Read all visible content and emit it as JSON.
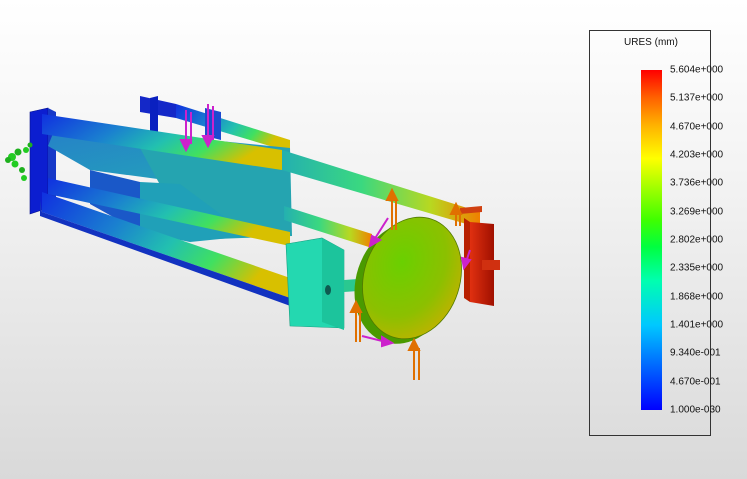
{
  "legend": {
    "title": "URES (mm)",
    "ticks": [
      "5.604e+000",
      "5.137e+000",
      "4.670e+000",
      "4.203e+000",
      "3.736e+000",
      "3.269e+000",
      "2.802e+000",
      "2.335e+000",
      "1.868e+000",
      "1.401e+000",
      "9.340e-001",
      "4.670e-001",
      "1.000e-030"
    ],
    "colors": {
      "max": "#ff0000",
      "high": "#ff8000",
      "mid": "#ffff00",
      "low_mid": "#00ff00",
      "low": "#00ffff",
      "min": "#0000ff"
    }
  },
  "model": {
    "fixture_color": "#22cc22",
    "force_color": "#e07000",
    "pressure_color": "#cc22cc"
  }
}
